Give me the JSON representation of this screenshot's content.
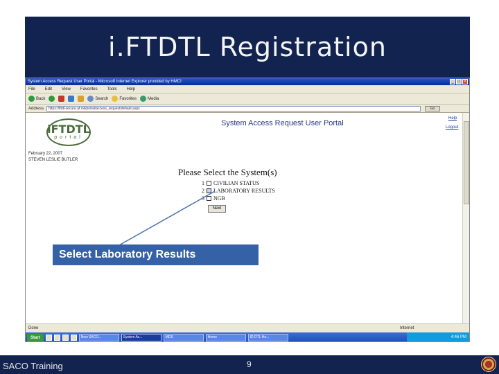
{
  "slide": {
    "title": "i.FTDTL Registration",
    "footer_left": "SACO Training",
    "page_number": "9",
    "callout": "Select Laboratory Results",
    "colors": {
      "banner": "#13234f",
      "callout": "#3561a6",
      "text_light": "#f4f4f4"
    }
  },
  "browser": {
    "window_title": "System Access Request User Portal - Microsoft Internet Explorer provided by HMCI",
    "menu": [
      "File",
      "Edit",
      "View",
      "Favorites",
      "Tools",
      "Help"
    ],
    "toolbar": [
      "Back",
      "Search",
      "Favorites",
      "Media"
    ],
    "address_label": "Address",
    "address_value": "https://ftdtl-secure.af.mil/portal/access_request/default.aspx",
    "go_label": "Go",
    "status_left": "Done",
    "status_zone": "Internet"
  },
  "page": {
    "logo_text": "iFTDTL",
    "logo_sub": "portal",
    "portal_title": "System Access Request User Portal",
    "help": "Help",
    "logout": "Logout",
    "date": "February 22, 2007",
    "user": "STEVEN LESLIE BUTLER",
    "heading": "Please Select the System(s)",
    "options": [
      {
        "num": "1",
        "label": "CIVILIAN STATUS",
        "checked": false
      },
      {
        "num": "2",
        "label": "LABORATORY RESULTS",
        "checked": true
      },
      {
        "num": "3",
        "label": "NGB",
        "checked": false
      }
    ],
    "next_button": "Next"
  },
  "taskbar": {
    "start": "Start",
    "items": [
      "New SACO...",
      "System Ac...",
      "MDS",
      "Home",
      "ID DTL Ho..."
    ],
    "clock": "4:46 PM"
  }
}
